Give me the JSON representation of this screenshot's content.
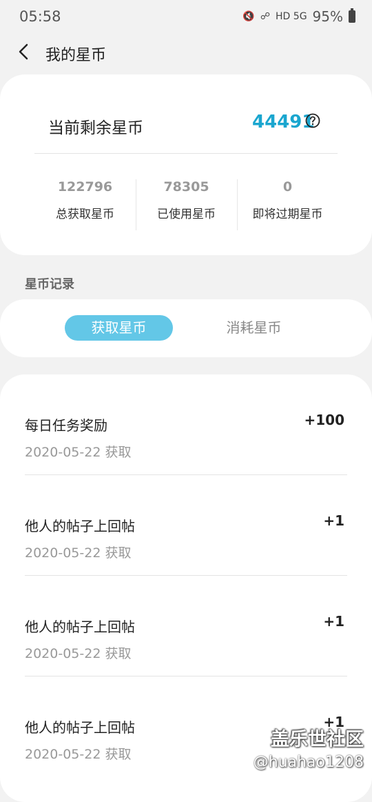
{
  "status_bar": {
    "time": "05:58",
    "network": "HD 5G",
    "battery": "95%"
  },
  "header": {
    "title": "我的星币"
  },
  "summary": {
    "balance_label": "当前剩余星币",
    "balance_value": "44491",
    "stats": [
      {
        "value": "122796",
        "label": "总获取星币"
      },
      {
        "value": "78305",
        "label": "已使用星币"
      },
      {
        "value": "0",
        "label": "即将过期星币"
      }
    ]
  },
  "records": {
    "section_title": "星币记录",
    "tabs": [
      {
        "label": "获取星币",
        "active": true
      },
      {
        "label": "消耗星币",
        "active": false
      }
    ],
    "items": [
      {
        "title": "每日任务奖励",
        "meta": "2020-05-22 获取",
        "amount": "+100"
      },
      {
        "title": "他人的帖子上回帖",
        "meta": "2020-05-22 获取",
        "amount": "+1"
      },
      {
        "title": "他人的帖子上回帖",
        "meta": "2020-05-22 获取",
        "amount": "+1"
      },
      {
        "title": "他人的帖子上回帖",
        "meta": "2020-05-22 获取",
        "amount": "+1"
      }
    ]
  },
  "watermark": {
    "brand": "盖乐世社区",
    "user": "@huahao1208"
  },
  "colors": {
    "accent": "#1aa6cf",
    "tab_active_bg": "#63c7e7",
    "background": "#f2f2f2"
  }
}
